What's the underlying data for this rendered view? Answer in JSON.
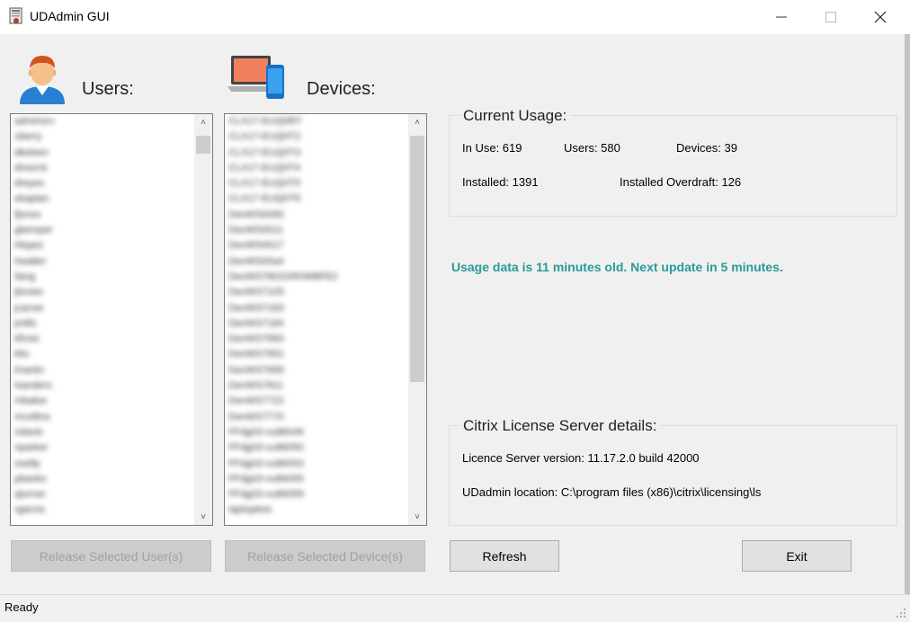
{
  "window": {
    "title": "UDAdmin GUI",
    "minimize_icon": "minimize-icon",
    "maximize_icon": "maximize-icon",
    "close_icon": "close-icon"
  },
  "users": {
    "label": "Users:",
    "icon": "user-icon",
    "items": [
      "adminsrv",
      "cberry",
      "dkelsen",
      "dmorris",
      "dreyes",
      "ekaplan",
      "fjones",
      "gkemper",
      "hlopez",
      "hwalter",
      "ilang",
      "jbrown",
      "jcarver",
      "jmills",
      "kfrost",
      "kliu",
      "lmartin",
      "lsanders",
      "mbaker",
      "mcollins",
      "ndavis",
      "nparker",
      "oreilly",
      "pbanks",
      "qturner",
      "rgarcia"
    ],
    "release_button": "Release Selected User(s)"
  },
  "devices": {
    "label": "Devices:",
    "icon": "laptop-phone-icon",
    "items": [
      "CLX17-EUQ0RT",
      "CLX17-EUQ0T2",
      "CLX17-EUQ0T3",
      "CLX17-EUQ0T4",
      "CLX17-EUQ0T5",
      "CLX17-EUQ0T6",
      "DevWS0090",
      "DevWS0011",
      "DevWS0017",
      "DevWS00a4",
      "DevWS7802GRHM8FE2",
      "DevWS7105",
      "DevWS7183",
      "DevWS7184",
      "DevWS7683",
      "DevWS7691",
      "DevWS7699",
      "DevWS7811",
      "DevWS7722",
      "DevWS7770",
      "FFdg03-vu86049",
      "FFdg03-vu86050",
      "FFdg03-vu86053",
      "FFdg03-vu86055",
      "FFdg03-vu86059",
      "laptoptest"
    ],
    "release_button": "Release Selected Device(s)"
  },
  "current_usage": {
    "title": "Current Usage:",
    "in_use": "In Use: 619",
    "users": "Users: 580",
    "devices": "Devices: 39",
    "installed": "Installed: 1391",
    "installed_overdraft": "Installed Overdraft: 126"
  },
  "usage_message": "Usage data is 11 minutes old. Next update in 5 minutes.",
  "license_server": {
    "title": "Citrix License Server details:",
    "version": "Licence Server version: 11.17.2.0 build 42000",
    "location": "UDadmin location: C:\\program files (x86)\\citrix\\licensing\\ls"
  },
  "buttons": {
    "refresh": "Refresh",
    "exit": "Exit"
  },
  "status": {
    "text": "Ready"
  },
  "colors": {
    "status_message": "#2a9a9a",
    "window_bg": "#f0f0f0"
  }
}
